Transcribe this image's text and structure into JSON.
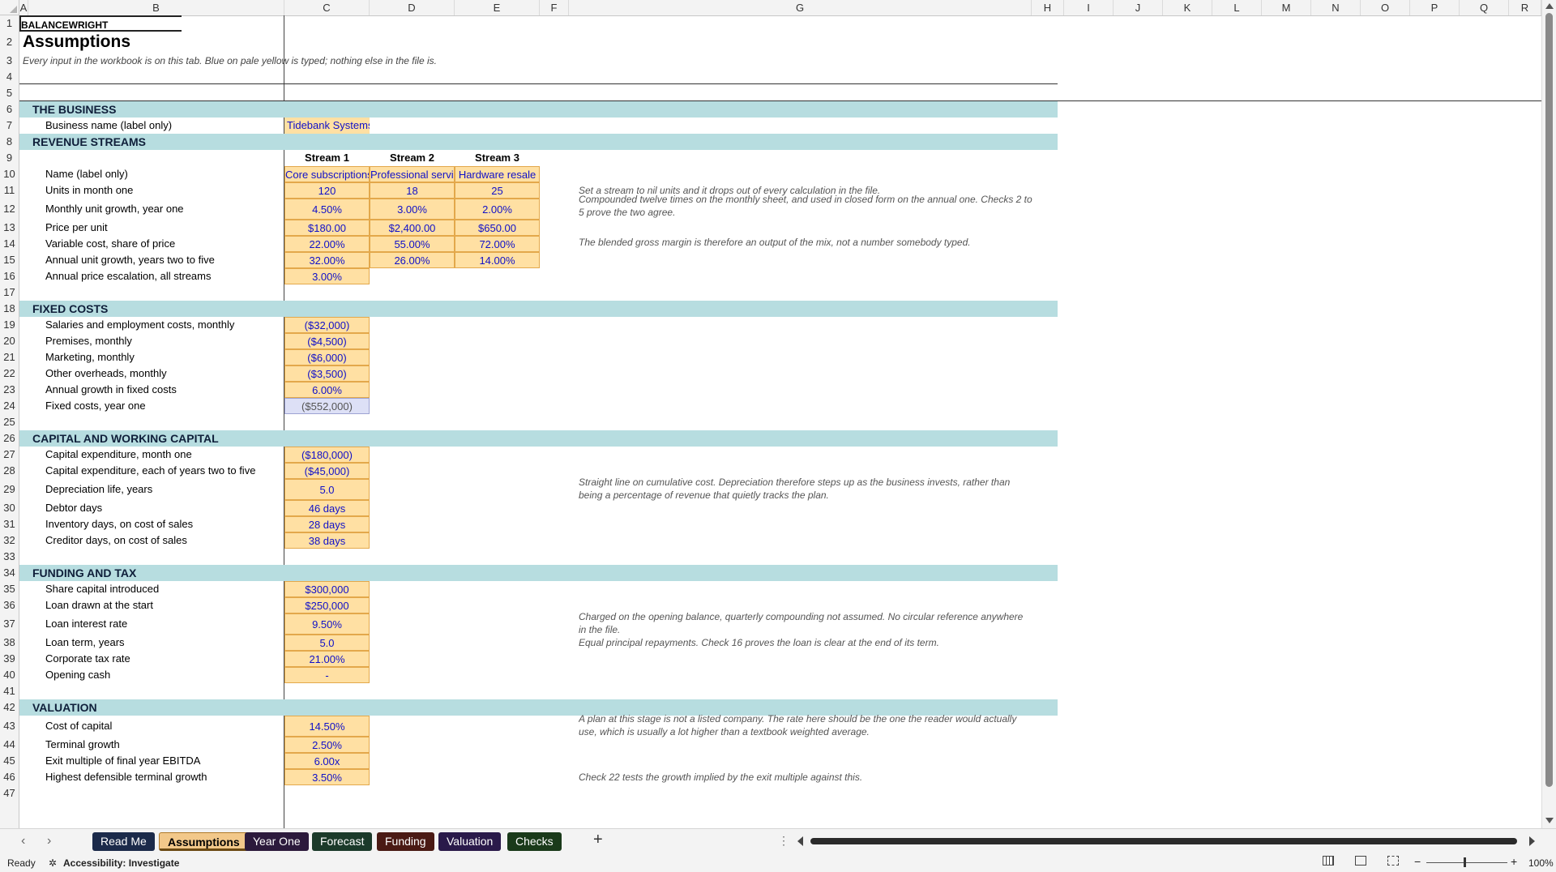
{
  "columns": [
    "A",
    "B",
    "C",
    "D",
    "E",
    "F",
    "G",
    "H",
    "I",
    "J",
    "K",
    "L",
    "M",
    "N",
    "O",
    "P",
    "Q",
    "R"
  ],
  "rows": [
    "1",
    "2",
    "3",
    "4",
    "5",
    "6",
    "7",
    "8",
    "9",
    "10",
    "11",
    "12",
    "13",
    "14",
    "15",
    "16",
    "17",
    "18",
    "19",
    "20",
    "21",
    "22",
    "23",
    "24",
    "25",
    "26",
    "27",
    "28",
    "29",
    "30",
    "31",
    "32",
    "33",
    "34",
    "35",
    "36",
    "37",
    "38",
    "39",
    "40",
    "41",
    "42",
    "43",
    "44",
    "45",
    "46",
    "47"
  ],
  "sheet": {
    "brand": "BALANCEWRIGHT",
    "title": "Assumptions",
    "subtitle": "Every input in the workbook is on this tab. Blue on pale yellow is typed; nothing else in the file is.",
    "sections": {
      "business": "THE BUSINESS",
      "revenue": "REVENUE STREAMS",
      "fixed": "FIXED COSTS",
      "capital": "CAPITAL AND WORKING CAPITAL",
      "funding": "FUNDING AND TAX",
      "valuation": "VALUATION"
    },
    "business_name_label": "Business name (label only)",
    "business_name": "Tidebank Systems",
    "stream_headers": [
      "Stream 1",
      "Stream 2",
      "Stream 3"
    ],
    "revenue_rows": [
      {
        "label": "Name (label only)",
        "values": [
          "Core subscriptions",
          "Professional services",
          "Hardware resale"
        ]
      },
      {
        "label": "Units in month one",
        "values": [
          "120",
          "18",
          "25"
        ]
      },
      {
        "label": "Monthly unit growth, year one",
        "values": [
          "4.50%",
          "3.00%",
          "2.00%"
        ]
      },
      {
        "label": "Price per unit",
        "values": [
          "$180.00",
          "$2,400.00",
          "$650.00"
        ]
      },
      {
        "label": "Variable cost, share of price",
        "values": [
          "22.00%",
          "55.00%",
          "72.00%"
        ]
      },
      {
        "label": "Annual unit growth, years two to five",
        "values": [
          "32.00%",
          "26.00%",
          "14.00%"
        ]
      },
      {
        "label": "Annual price escalation, all streams",
        "values": [
          "3.00%"
        ]
      }
    ],
    "fixed_rows": [
      {
        "label": "Salaries and employment costs, monthly",
        "value": "($32,000)"
      },
      {
        "label": "Premises, monthly",
        "value": "($4,500)"
      },
      {
        "label": "Marketing, monthly",
        "value": "($6,000)"
      },
      {
        "label": "Other overheads, monthly",
        "value": "($3,500)"
      },
      {
        "label": "Annual growth in fixed costs",
        "value": "6.00%"
      },
      {
        "label": "Fixed costs, year one",
        "value": "($552,000)"
      }
    ],
    "capital_rows": [
      {
        "label": "Capital expenditure, month one",
        "value": "($180,000)"
      },
      {
        "label": "Capital expenditure, each of years two to five",
        "value": "($45,000)"
      },
      {
        "label": "Depreciation life, years",
        "value": "5.0"
      },
      {
        "label": "Debtor days",
        "value": "46 days"
      },
      {
        "label": "Inventory days, on cost of sales",
        "value": "28 days"
      },
      {
        "label": "Creditor days, on cost of sales",
        "value": "38 days"
      }
    ],
    "funding_rows": [
      {
        "label": "Share capital introduced",
        "value": "$300,000"
      },
      {
        "label": "Loan drawn at the start",
        "value": "$250,000"
      },
      {
        "label": "Loan interest rate",
        "value": "9.50%"
      },
      {
        "label": "Loan term, years",
        "value": "5.0"
      },
      {
        "label": "Corporate tax rate",
        "value": "21.00%"
      },
      {
        "label": "Opening cash",
        "value": "-"
      }
    ],
    "valuation_rows": [
      {
        "label": "Cost of capital",
        "value": "14.50%"
      },
      {
        "label": "Terminal growth",
        "value": "2.50%"
      },
      {
        "label": "Exit multiple of final year EBITDA",
        "value": "6.00x"
      },
      {
        "label": "Highest defensible terminal growth",
        "value": "3.50%"
      }
    ],
    "notes": {
      "r11": "Set a stream to nil units and it drops out of every calculation in the file.",
      "r12": "Compounded twelve times on the monthly sheet, and used in closed form on the annual one. Checks 2 to 5 prove the two agree.",
      "r14": "The blended gross margin is therefore an output of the mix, not a number somebody typed.",
      "r29": "Straight line on cumulative cost. Depreciation therefore steps up as the business invests, rather than being a percentage of revenue that quietly tracks the plan.",
      "r37": "Charged on the opening balance, quarterly compounding not assumed. No circular reference anywhere in the file.",
      "r38": "Equal principal repayments. Check 16 proves the loan is clear at the end of its term.",
      "r43": "A plan at this stage is not a listed company. The rate here should be the one the reader would actually use, which is usually a lot higher than a textbook weighted average.",
      "r46": "Check 22 tests the growth implied by the exit multiple against this."
    }
  },
  "tabs": [
    {
      "label": "Read Me",
      "bg": "#1b2a4a",
      "fg": "#ffffff"
    },
    {
      "label": "Assumptions",
      "bg": "#f2c88a",
      "fg": "#000000"
    },
    {
      "label": "Year One",
      "bg": "#2c1a3c",
      "fg": "#ffffff"
    },
    {
      "label": "Forecast",
      "bg": "#1b3a2a",
      "fg": "#ffffff"
    },
    {
      "label": "Funding",
      "bg": "#4a1a14",
      "fg": "#ffffff"
    },
    {
      "label": "Valuation",
      "bg": "#2a1a4a",
      "fg": "#ffffff"
    },
    {
      "label": "Checks",
      "bg": "#1a3a1a",
      "fg": "#ffffff"
    }
  ],
  "tab_add": "+",
  "tab_options": "⋮",
  "status": {
    "ready": "Ready",
    "accessibility": "Accessibility: Investigate",
    "zoom": "100%",
    "zoom_minus": "−",
    "zoom_plus": "+"
  },
  "colors": {
    "section_band": "#b7dde0",
    "input_fill": "#ffe0a3",
    "input_text": "#1010c8"
  }
}
